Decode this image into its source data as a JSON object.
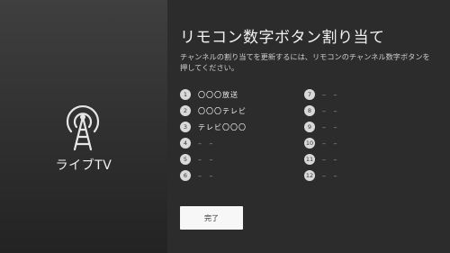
{
  "sidebar": {
    "label": "ライブTV",
    "icon": "broadcast-tower-icon"
  },
  "main": {
    "title": "リモコン数字ボタン割り当て",
    "description": "チャンネルの割り当てを更新するには、リモコンのチャンネル数字ボタンを押してください。",
    "channels_left": [
      {
        "num": "1",
        "name": "〇〇〇放送"
      },
      {
        "num": "2",
        "name": "〇〇〇テレビ"
      },
      {
        "num": "3",
        "name": "テレビ〇〇〇"
      },
      {
        "num": "4",
        "name": "– –"
      },
      {
        "num": "5",
        "name": "– –"
      },
      {
        "num": "6",
        "name": "– –"
      }
    ],
    "channels_right": [
      {
        "num": "7",
        "name": "– –"
      },
      {
        "num": "8",
        "name": "– –"
      },
      {
        "num": "9",
        "name": "– –"
      },
      {
        "num": "10",
        "name": "– –"
      },
      {
        "num": "11",
        "name": "– –"
      },
      {
        "num": "12",
        "name": "– –"
      }
    ],
    "done_label": "完了"
  },
  "colors": {
    "sidebar_bg": "#353535",
    "main_bg": "#2c2c2c",
    "button_bg": "#f7f7f7",
    "badge_bg": "#d9d9d9"
  }
}
